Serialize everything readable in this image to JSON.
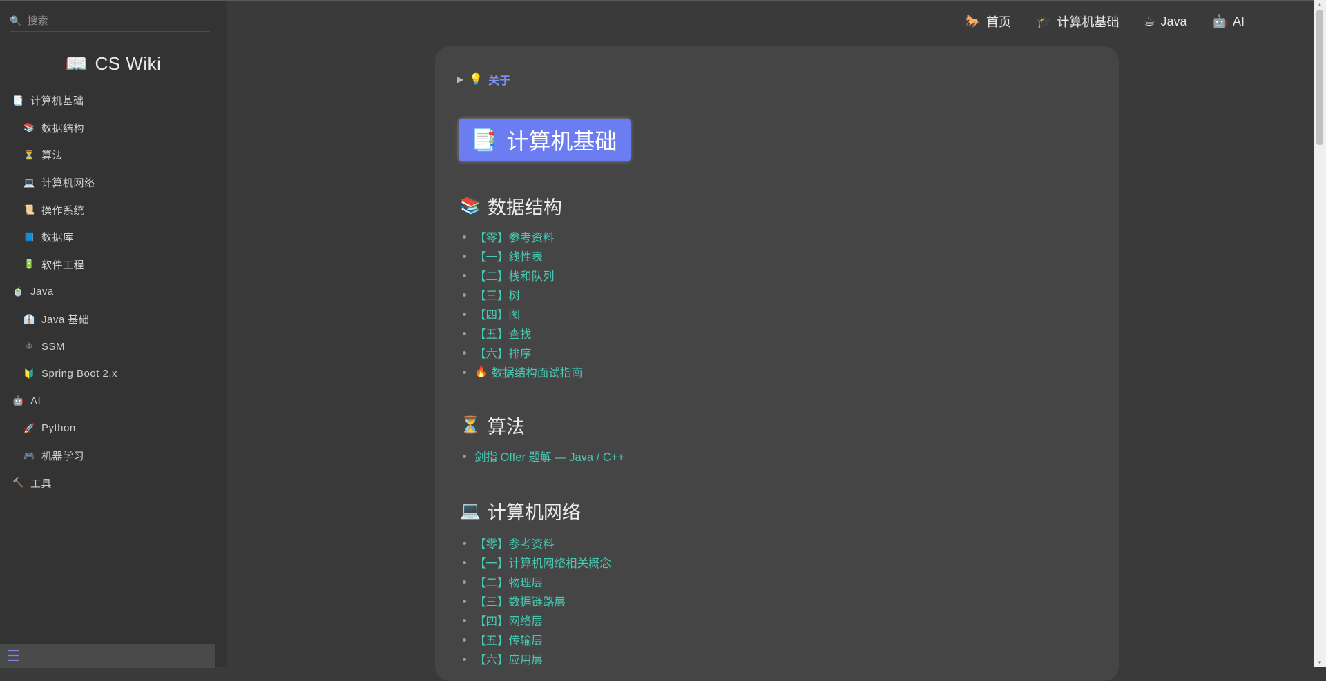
{
  "search": {
    "placeholder": "搜索"
  },
  "site": {
    "logo_icon": "📖",
    "title": "CS Wiki"
  },
  "sidebar": {
    "items": [
      {
        "icon": "📑",
        "label": "计算机基础",
        "level": 1
      },
      {
        "icon": "📚",
        "label": "数据结构",
        "level": 2
      },
      {
        "icon": "⏳",
        "label": "算法",
        "level": 2
      },
      {
        "icon": "💻",
        "label": "计算机网络",
        "level": 2
      },
      {
        "icon": "📜",
        "label": "操作系统",
        "level": 2
      },
      {
        "icon": "📘",
        "label": "数据库",
        "level": 2
      },
      {
        "icon": "🔋",
        "label": "软件工程",
        "level": 2
      },
      {
        "icon": "🍵",
        "label": "Java",
        "level": 1
      },
      {
        "icon": "👔",
        "label": "Java 基础",
        "level": 2
      },
      {
        "icon": "⚛",
        "label": "SSM",
        "level": 2
      },
      {
        "icon": "🔰",
        "label": "Spring Boot 2.x",
        "level": 2
      },
      {
        "icon": "🤖",
        "label": "AI",
        "level": 1
      },
      {
        "icon": "🚀",
        "label": "Python",
        "level": 2
      },
      {
        "icon": "🎮",
        "label": "机器学习",
        "level": 2
      },
      {
        "icon": "🔨",
        "label": "工具",
        "level": 1
      }
    ],
    "toggle_icon": "☰"
  },
  "topnav": {
    "items": [
      {
        "icon": "🐎",
        "label": "首页"
      },
      {
        "icon": "🎓",
        "label": "计算机基础"
      },
      {
        "icon": "☕",
        "label": "Java"
      },
      {
        "icon": "🤖",
        "label": "AI"
      }
    ]
  },
  "content": {
    "about": {
      "toggle": "▶",
      "icon": "💡",
      "label": "关于"
    },
    "title": {
      "icon": "📑",
      "text": "计算机基础"
    },
    "sections": [
      {
        "icon": "📚",
        "title": "数据结构",
        "links": [
          "【零】参考资料",
          "【一】线性表",
          "【二】栈和队列",
          "【三】树",
          "【四】图",
          "【五】查找",
          "【六】排序",
          "数据结构面试指南"
        ],
        "link8_icon": "🔥"
      },
      {
        "icon": "⏳",
        "title": "算法",
        "links": [
          "剑指 Offer 题解 — Java / C++"
        ]
      },
      {
        "icon": "💻",
        "title": "计算机网络",
        "links": [
          "【零】参考资料",
          "【一】计算机网络相关概念",
          "【二】物理层",
          "【三】数据链路层",
          "【四】网络层",
          "【五】传输层",
          "【六】应用层"
        ]
      }
    ]
  },
  "colors": {
    "accent": "#6c7df2",
    "link": "#49c9b3",
    "about": "#7b90f0"
  }
}
